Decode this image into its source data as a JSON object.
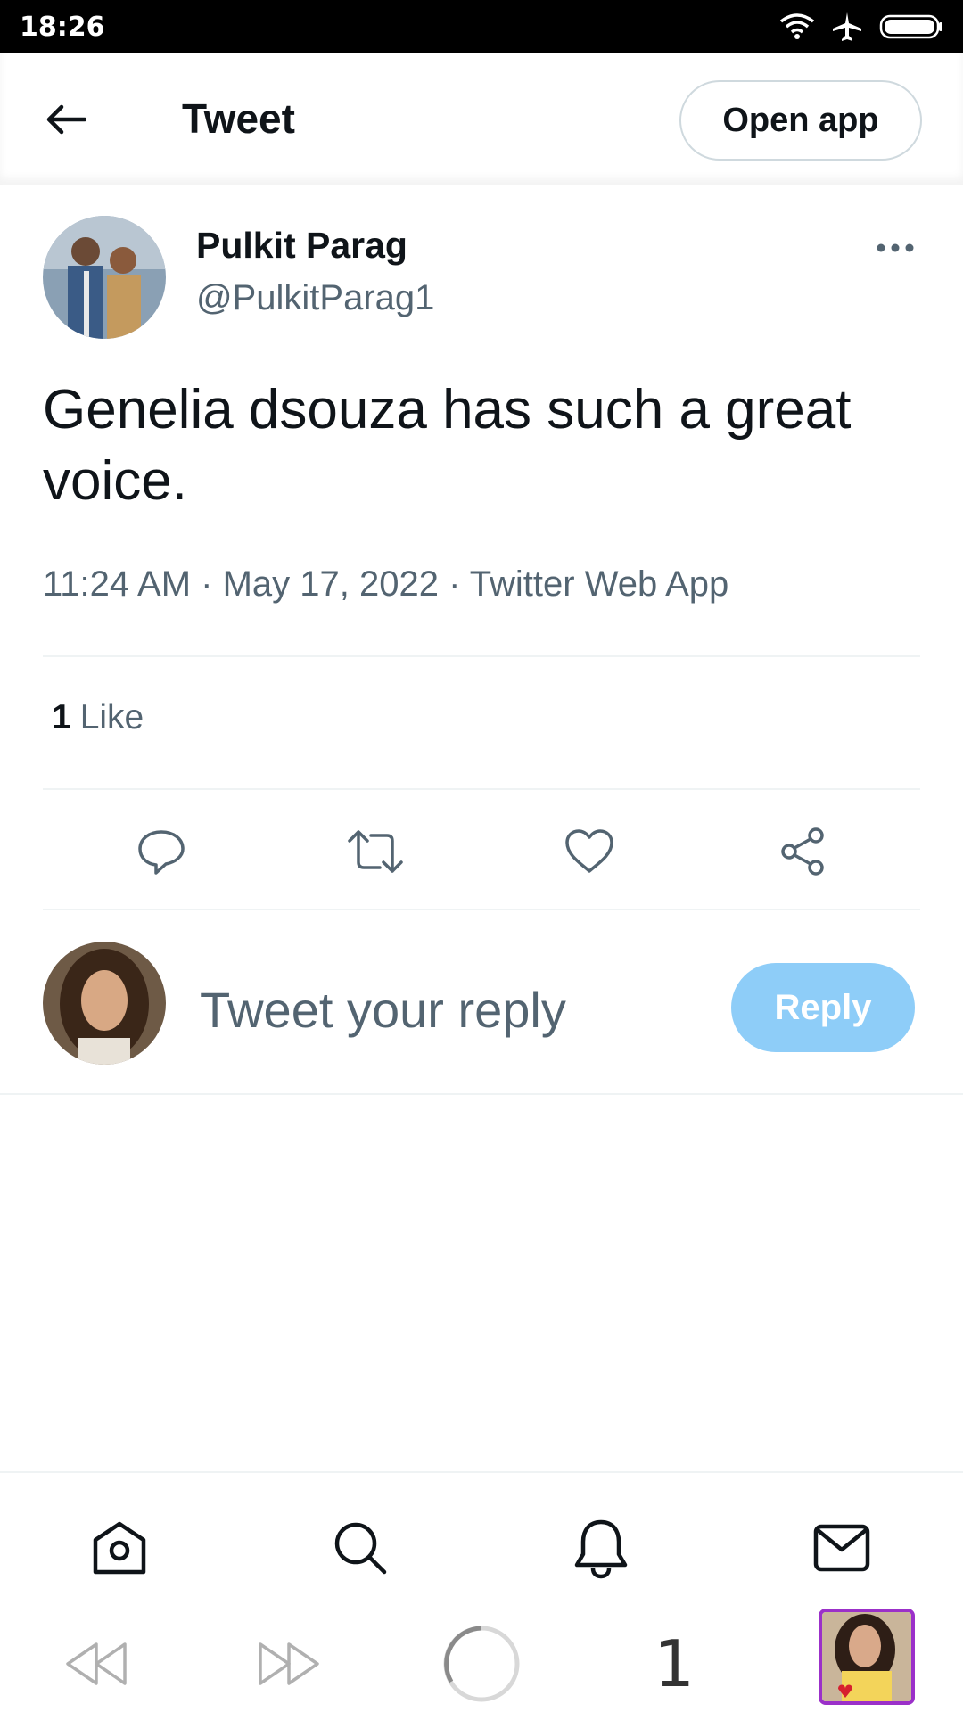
{
  "status_bar": {
    "time": "18:26"
  },
  "header": {
    "title": "Tweet",
    "open_app_label": "Open app"
  },
  "tweet": {
    "author_name": "Pulkit Parag",
    "author_handle": "@PulkitParag1",
    "text": "Genelia dsouza has such a great voice.",
    "meta": "11:24 AM · May 17, 2022 · Twitter Web App",
    "like_count": "1",
    "like_label": "Like"
  },
  "reply": {
    "placeholder": "Tweet your reply",
    "button_label": "Reply"
  },
  "browser": {
    "tab_count": "1"
  },
  "colors": {
    "reply_button": "#8ecdf8",
    "secondary_text": "#536471",
    "primary_text": "#0f1419",
    "divider": "#eff3f4"
  },
  "icons": {
    "header": [
      "back-arrow-icon",
      "more-options-icon"
    ],
    "actions": [
      "reply-icon",
      "retweet-icon",
      "like-icon",
      "share-icon"
    ],
    "nav": [
      "home-icon",
      "search-icon",
      "notifications-icon",
      "messages-icon"
    ],
    "browser": [
      "back-icon",
      "forward-icon",
      "loading-icon"
    ]
  }
}
